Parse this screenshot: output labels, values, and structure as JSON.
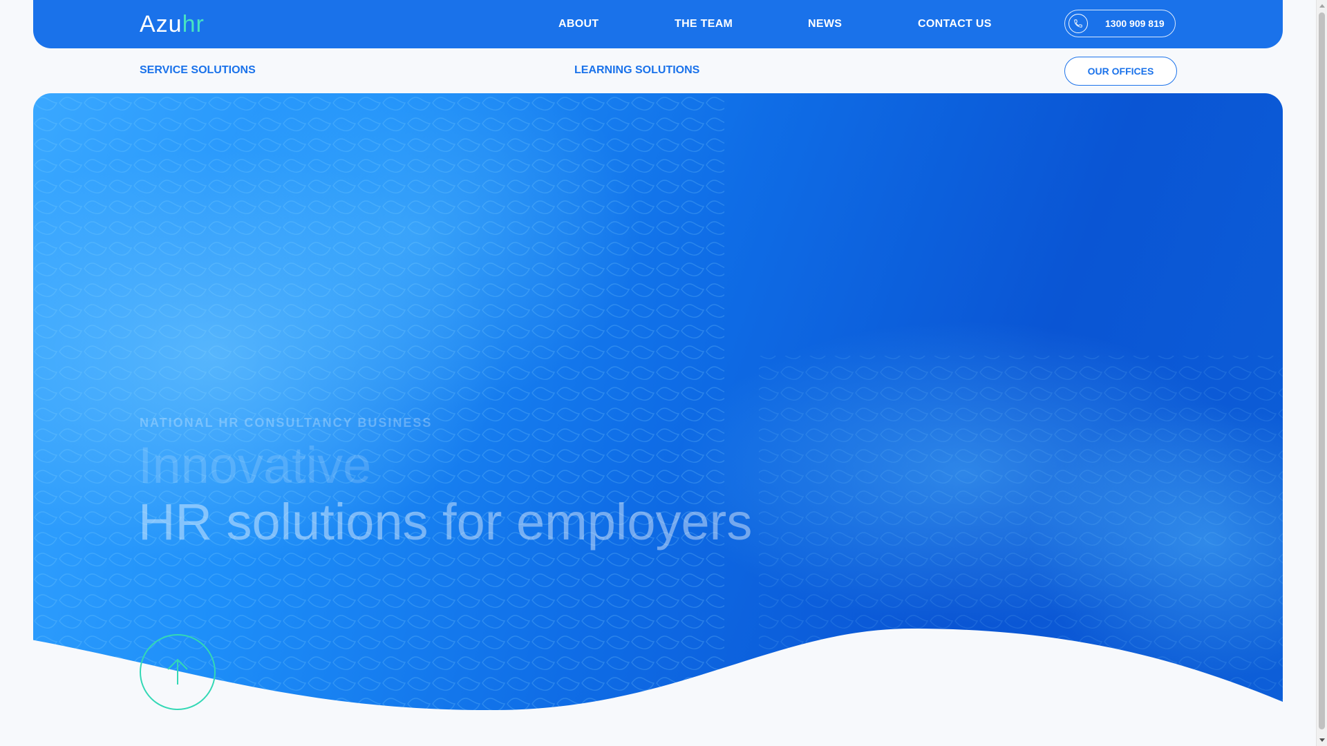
{
  "brand": {
    "logo_part1": "Azu",
    "logo_part2": "hr"
  },
  "nav": {
    "items": [
      {
        "label": "ABOUT"
      },
      {
        "label": "THE TEAM"
      },
      {
        "label": "NEWS"
      },
      {
        "label": "CONTACT US"
      }
    ],
    "phone": "1300 909 819"
  },
  "subnav": {
    "service": "SERVICE SOLUTIONS",
    "learning": "LEARNING SOLUTIONS",
    "offices": "OUR OFFICES"
  },
  "hero": {
    "eyebrow": "NATIONAL HR CONSULTANCY BUSINESS",
    "headline_line1": "Innovative",
    "headline_line2": "HR solutions for employers"
  },
  "icons": {
    "phone": "phone-icon",
    "scroll": "arrow-up-icon"
  },
  "colors": {
    "brand_blue": "#1a72ea",
    "accent_teal": "#47e3c1",
    "page_bg": "#f7f9fc"
  }
}
